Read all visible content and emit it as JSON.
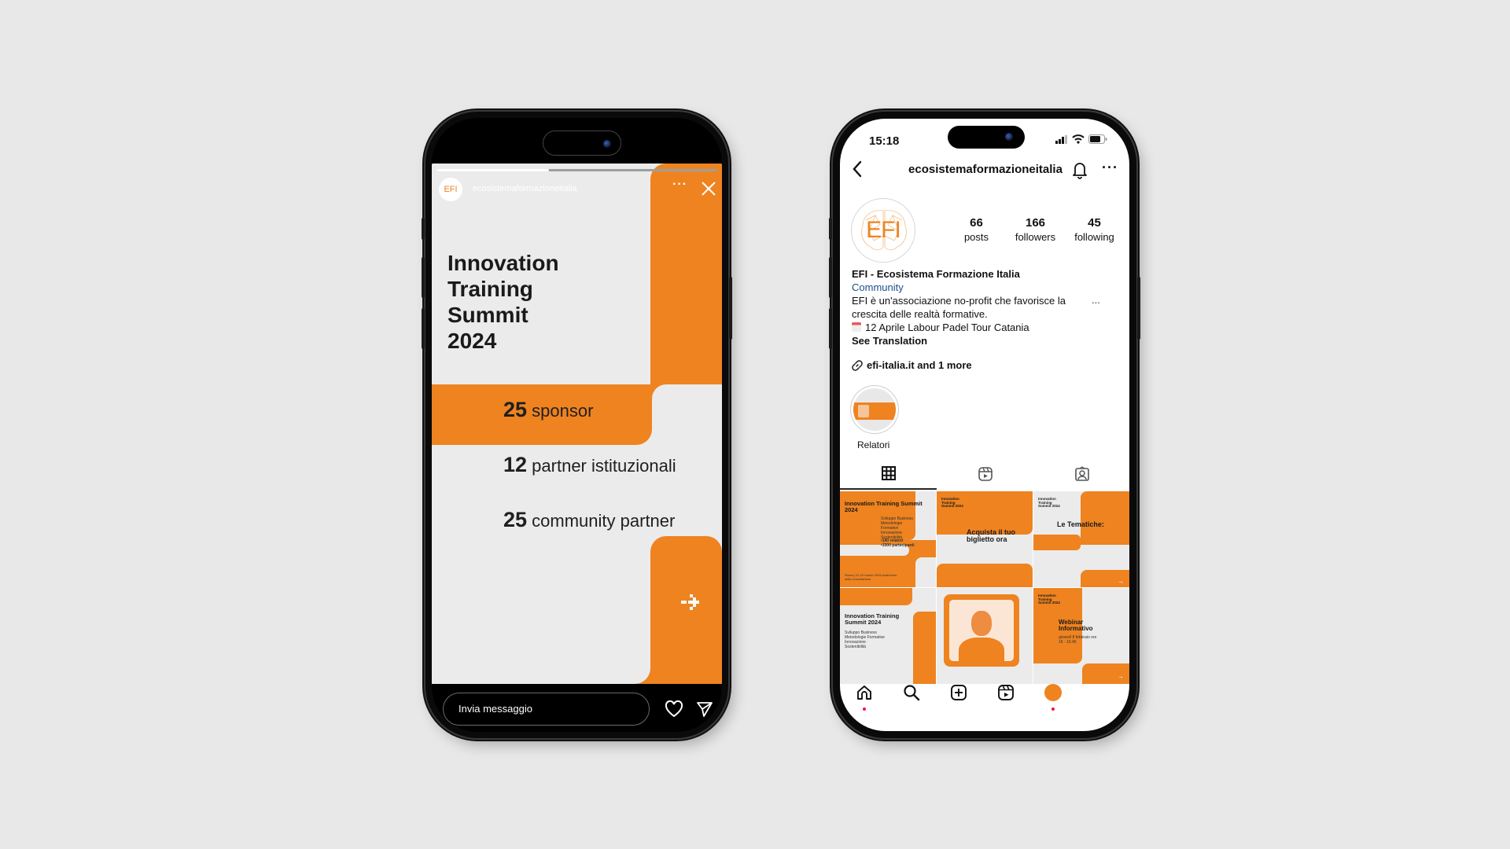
{
  "story_screen": {
    "username": "ecosistemaformazioneitalia",
    "avatar_text": "EFI",
    "progress_fraction": 0.4,
    "title_lines": [
      "Innovation",
      "Training",
      "Summit",
      "2024"
    ],
    "stats": [
      {
        "number": "25",
        "label": "sponsor"
      },
      {
        "number": "12",
        "label": "partner istituzionali"
      },
      {
        "number": "25",
        "label": "community partner"
      }
    ],
    "message_placeholder": "Invia messaggio",
    "icons": {
      "more": "more-icon",
      "close": "close-icon",
      "next": "arrow-right-icon",
      "like": "heart-icon",
      "send": "send-icon"
    }
  },
  "profile_screen": {
    "status_bar": {
      "time": "15:18"
    },
    "header": {
      "username": "ecosistemaformazioneitalia"
    },
    "avatar_text": "EFI",
    "stats": [
      {
        "value": "66",
        "label": "posts"
      },
      {
        "value": "166",
        "label": "followers"
      },
      {
        "value": "45",
        "label": "following"
      }
    ],
    "bio": {
      "name": "EFI - Ecosistema Formazione Italia",
      "category": "Community",
      "line1": "EFI è un'associazione no-profit che favorisce la",
      "line2": "crescita delle realtà formative.",
      "event": "12 Aprile Labour Padel Tour Catania",
      "see_translation": "See Translation",
      "more": "..."
    },
    "link": "efi-italia.it and 1 more",
    "highlights": [
      {
        "label": "Relatori"
      }
    ],
    "tabs": [
      {
        "name": "grid",
        "active": true
      },
      {
        "name": "reels",
        "active": false
      },
      {
        "name": "tagged",
        "active": false
      }
    ],
    "posts": [
      {
        "title": "Innovation Training Summit 2024",
        "topics": [
          "Sviluppo Business",
          "Metodologie Formative",
          "Innovazione",
          "Sostenibilità"
        ],
        "bullets": [
          "•190 relatori",
          "•1500 partecipanti"
        ],
        "footer": "Roma | 21-22 marzo 2024 Auditorium della Conciliazione"
      },
      {
        "header": "Innovation Training Summit 2024",
        "title": "Acquista il tuo biglietto ora"
      },
      {
        "header": "Innovation Training Summit 2024",
        "title": "Le Tematiche:"
      },
      {
        "title": "Innovation Training Summit 2024",
        "topics": [
          "Sviluppo Business",
          "Metodologie Formative",
          "Innovazione",
          "Sostenibilità"
        ]
      },
      {
        "type": "speaker-photo"
      },
      {
        "header": "Innovation Training Summit 2024",
        "title": "Webinar Informativo",
        "subtitle": "giovedì 8 febbraio ore 16 - 16:45"
      }
    ],
    "colors": {
      "brand": "#ee8320",
      "notification_dot": "#f0153e"
    }
  }
}
